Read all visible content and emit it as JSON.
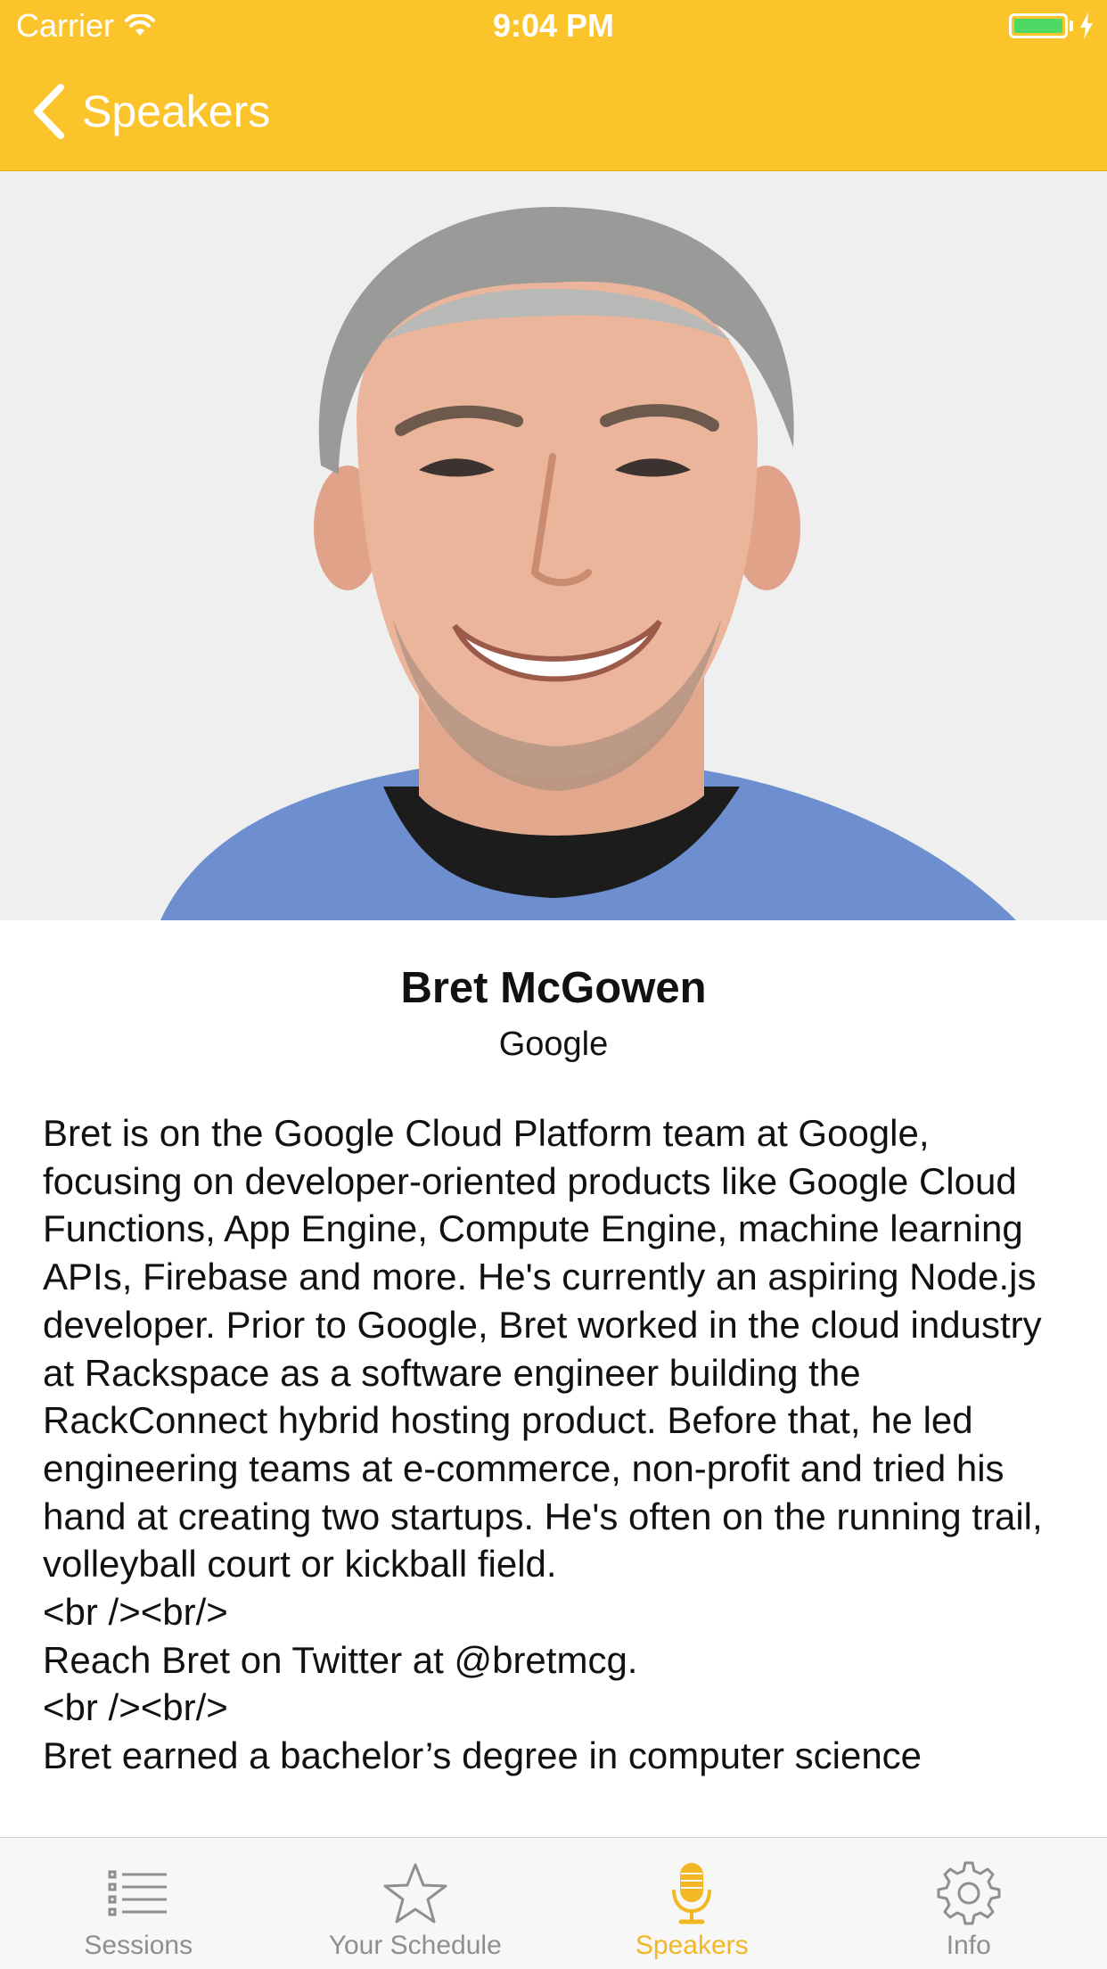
{
  "status_bar": {
    "carrier": "Carrier",
    "time": "9:04 PM",
    "battery_color": "#4cd964"
  },
  "nav": {
    "back_label": "Speakers",
    "back_icon": "chevron-left-icon",
    "bar_color": "#fbc42a"
  },
  "speaker": {
    "photo_description_icon": "speaker-photo",
    "name": "Bret McGowen",
    "company": "Google",
    "bio": "Bret is on the Google Cloud Platform team at Google, focusing on developer-oriented products like Google Cloud Functions, App Engine, Compute Engine, machine learning APIs, Firebase and more. He's currently an aspiring Node.js developer. Prior to Google, Bret worked in the cloud industry at Rackspace as a software engineer building the RackConnect hybrid hosting product. Before that, he led engineering teams at e-commerce, non-profit and tried his hand at creating two startups. He's often on the running trail, volleyball court or kickball field.\n<br /><br/>\nReach Bret on Twitter at @bretmcg.\n<br /><br/>\nBret earned a bachelor’s degree in computer science"
  },
  "tab_bar": {
    "tabs": [
      {
        "label": "Sessions",
        "icon": "list-icon",
        "active": false
      },
      {
        "label": "Your Schedule",
        "icon": "star-icon",
        "active": false
      },
      {
        "label": "Speakers",
        "icon": "microphone-icon",
        "active": true
      },
      {
        "label": "Info",
        "icon": "gear-icon",
        "active": false
      }
    ],
    "active_color": "#f2b824",
    "inactive_color": "#8e8e93"
  }
}
